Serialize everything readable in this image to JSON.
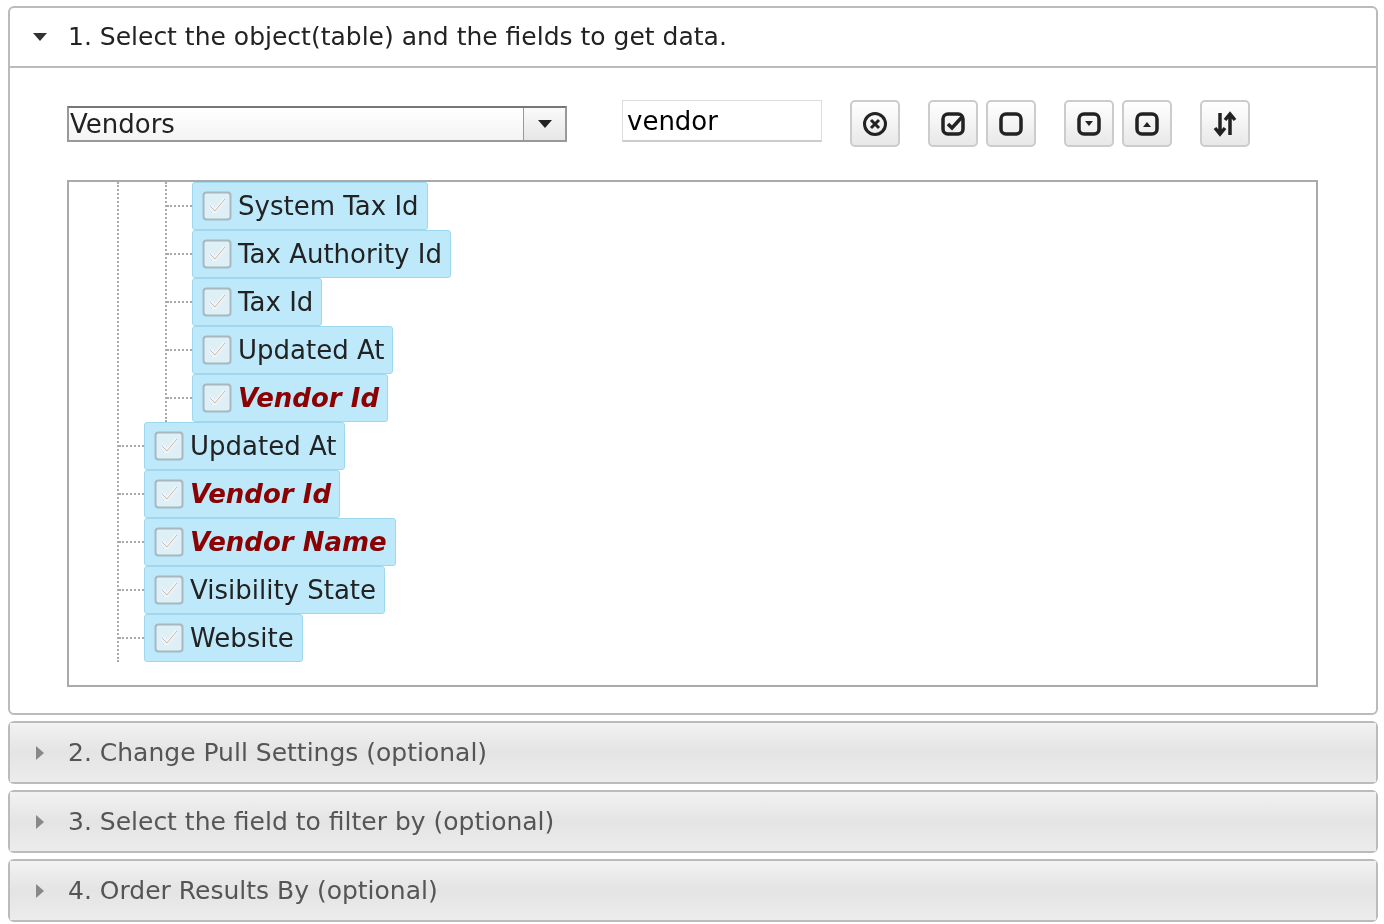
{
  "sections": [
    {
      "title": "1. Select the object(table) and the fields to get data.",
      "expanded": true
    },
    {
      "title": "2. Change Pull Settings (optional)",
      "expanded": false
    },
    {
      "title": "3. Select the field to filter by (optional)",
      "expanded": false
    },
    {
      "title": "4. Order Results By (optional)",
      "expanded": false
    }
  ],
  "object_select": {
    "value": "Vendors"
  },
  "search": {
    "value": "vendor"
  },
  "tree": [
    {
      "children": [
        {
          "label": "System Tax Id",
          "checked": true,
          "selected": true,
          "key": false
        },
        {
          "label": "Tax Authority Id",
          "checked": true,
          "selected": true,
          "key": false
        },
        {
          "label": "Tax Id",
          "checked": true,
          "selected": true,
          "key": false
        },
        {
          "label": "Updated At",
          "checked": true,
          "selected": true,
          "key": false
        },
        {
          "label": "Vendor Id",
          "checked": true,
          "selected": true,
          "key": true
        }
      ]
    },
    {
      "label": "Updated At",
      "checked": true,
      "selected": true,
      "key": false
    },
    {
      "label": "Vendor Id",
      "checked": true,
      "selected": true,
      "key": true
    },
    {
      "label": "Vendor Name",
      "checked": true,
      "selected": true,
      "key": true
    },
    {
      "label": "Visibility State",
      "checked": true,
      "selected": true,
      "key": false
    },
    {
      "label": "Website",
      "checked": true,
      "selected": true,
      "key": false
    }
  ]
}
